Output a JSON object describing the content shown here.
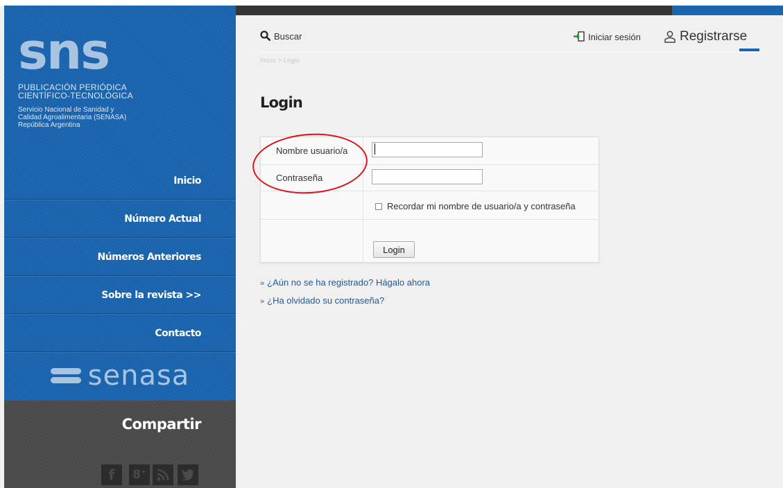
{
  "sidebar": {
    "logo_text": "sns",
    "publication_line1": "PUBLICACIÓN   PERIÓDICA",
    "publication_line2": "CIENTÍFICO-TECNOLÓGICA",
    "org_line1": "Servicio Nacional de Sanidad y",
    "org_line2": "Calidad Agroalimentaria (SENASA)",
    "org_line3": "República Argentina",
    "nav": [
      {
        "label": "Inicio"
      },
      {
        "label": "Número Actual"
      },
      {
        "label": "Números Anteriores"
      },
      {
        "label": "Sobre la revista >>"
      },
      {
        "label": "Contacto"
      }
    ],
    "partner_logo": "senasa",
    "share_title": "Compartir",
    "social_icons": [
      "facebook-icon",
      "google-plus-icon",
      "rss-icon",
      "twitter-icon"
    ]
  },
  "header": {
    "search_label": "Buscar",
    "login_label": "Iniciar sesión",
    "register_label": "Registrarse"
  },
  "breadcrumb": "Inicio > Login",
  "page_title": "Login",
  "form": {
    "username_label": "Nombre usuario/a",
    "username_value": "",
    "password_label": "Contraseña",
    "password_value": "",
    "remember_label": "Recordar mi nombre de usuario/a y contraseña",
    "remember_checked": false,
    "submit_label": "Login"
  },
  "links": {
    "register_prompt": "¿Aún no se ha registrado? Hágalo ahora",
    "forgot_password": "¿Ha olvidado su contraseña?"
  },
  "colors": {
    "brand_blue": "#1a63ad",
    "dark_bar": "#353535",
    "annotation_red": "#e0101a",
    "link_blue": "#1c5aa0"
  }
}
